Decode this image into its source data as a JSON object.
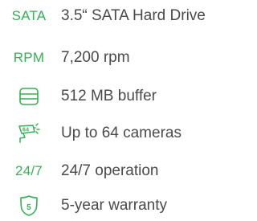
{
  "colors": {
    "accent": "#35b055",
    "text": "#4a4a4a",
    "background": "#ffffff"
  },
  "features": [
    {
      "badge": "SATA",
      "text": "3.5“ SATA Hard Drive"
    },
    {
      "badge": "RPM",
      "text": "7,200 rpm"
    },
    {
      "icon": "database-icon",
      "text": "512 MB buffer"
    },
    {
      "icon": "camera-64-icon",
      "icon_label": "64",
      "text": "Up to 64 cameras"
    },
    {
      "badge": "24/7",
      "text": "24/7 operation"
    },
    {
      "icon": "shield-icon",
      "icon_label": "5",
      "text": "5-year warranty"
    }
  ]
}
